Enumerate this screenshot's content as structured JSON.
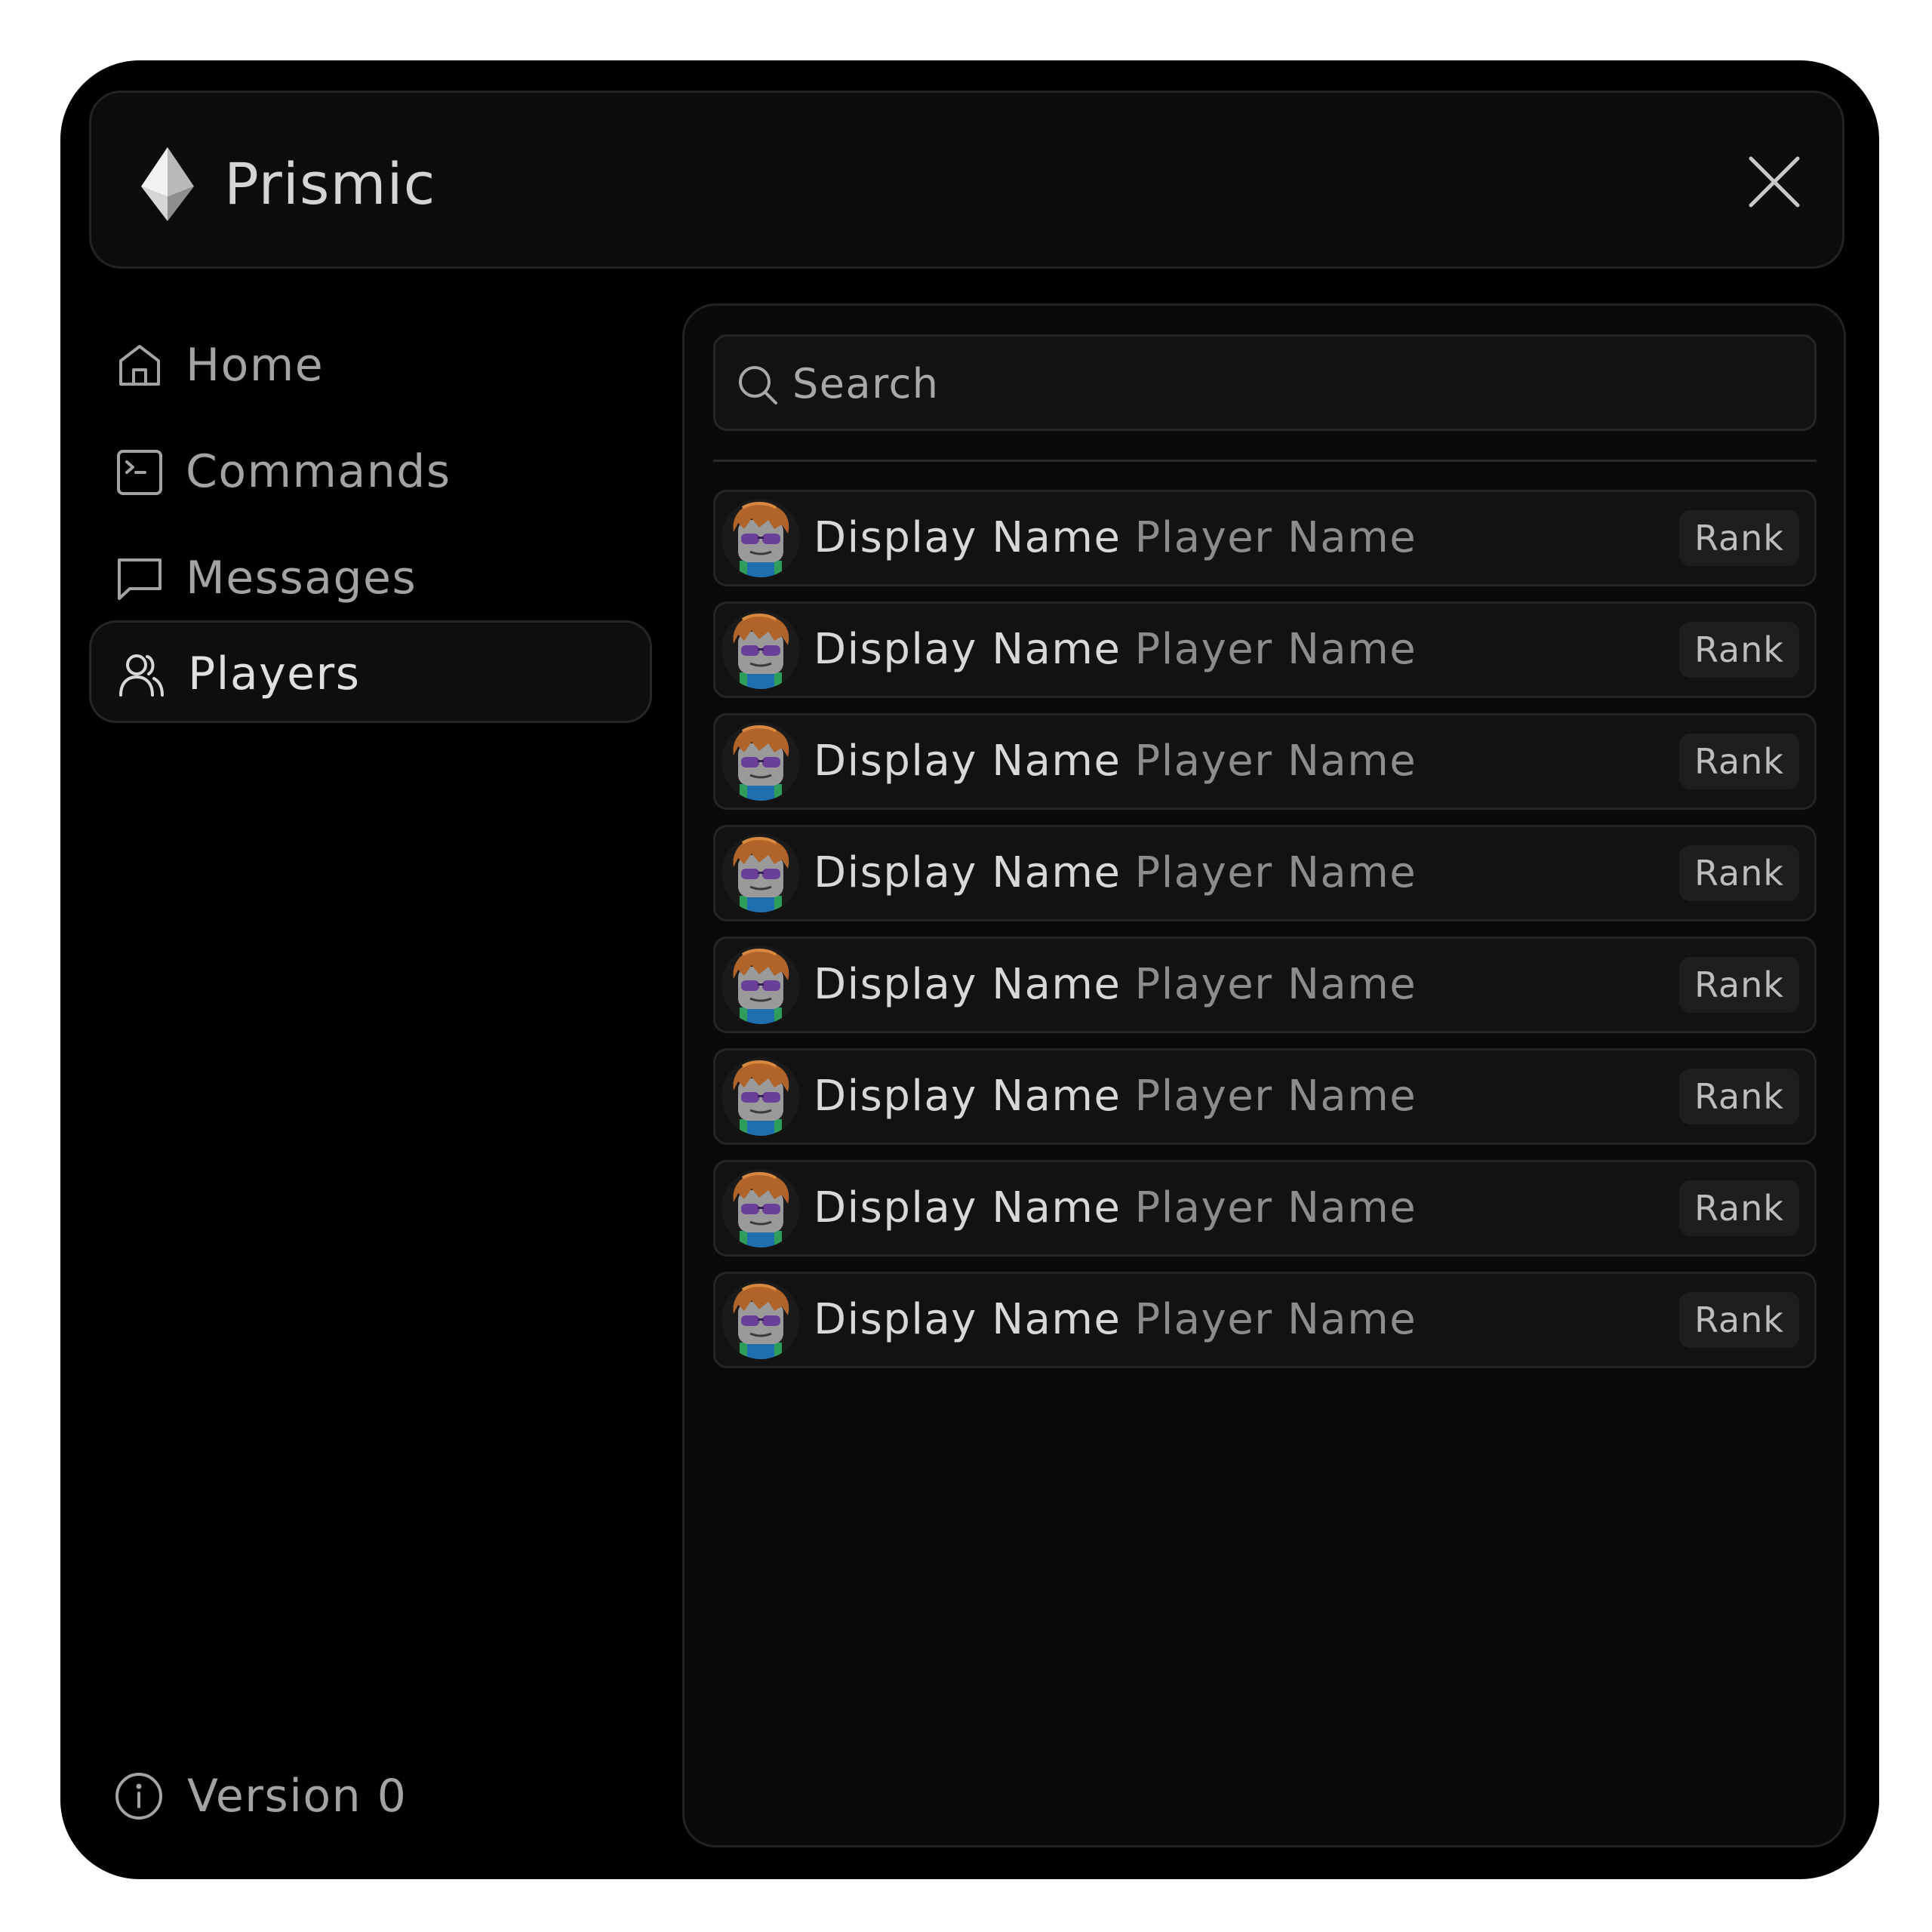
{
  "header": {
    "title": "Prismic",
    "logo_icon": "diamond-icon",
    "close_icon": "close-icon"
  },
  "sidebar": {
    "items": [
      {
        "label": "Home",
        "icon": "home-icon",
        "active": false
      },
      {
        "label": "Commands",
        "icon": "terminal-icon",
        "active": false
      },
      {
        "label": "Messages",
        "icon": "message-icon",
        "active": false
      },
      {
        "label": "Players",
        "icon": "users-icon",
        "active": true
      }
    ],
    "version_label": "Version 0",
    "version_icon": "info-icon"
  },
  "main": {
    "search": {
      "placeholder": "Search",
      "value": ""
    },
    "players": [
      {
        "display_name": "Display Name",
        "player_name": "Player Name",
        "rank": "Rank"
      },
      {
        "display_name": "Display Name",
        "player_name": "Player Name",
        "rank": "Rank"
      },
      {
        "display_name": "Display Name",
        "player_name": "Player Name",
        "rank": "Rank"
      },
      {
        "display_name": "Display Name",
        "player_name": "Player Name",
        "rank": "Rank"
      },
      {
        "display_name": "Display Name",
        "player_name": "Player Name",
        "rank": "Rank"
      },
      {
        "display_name": "Display Name",
        "player_name": "Player Name",
        "rank": "Rank"
      },
      {
        "display_name": "Display Name",
        "player_name": "Player Name",
        "rank": "Rank"
      },
      {
        "display_name": "Display Name",
        "player_name": "Player Name",
        "rank": "Rank"
      }
    ]
  },
  "colors": {
    "window_bg": "#000000",
    "panel_bg": "#0a0a0a",
    "row_bg": "#121212",
    "border": "#252525",
    "text_primary": "#d8d8d8",
    "text_secondary": "#8c8c8c"
  }
}
